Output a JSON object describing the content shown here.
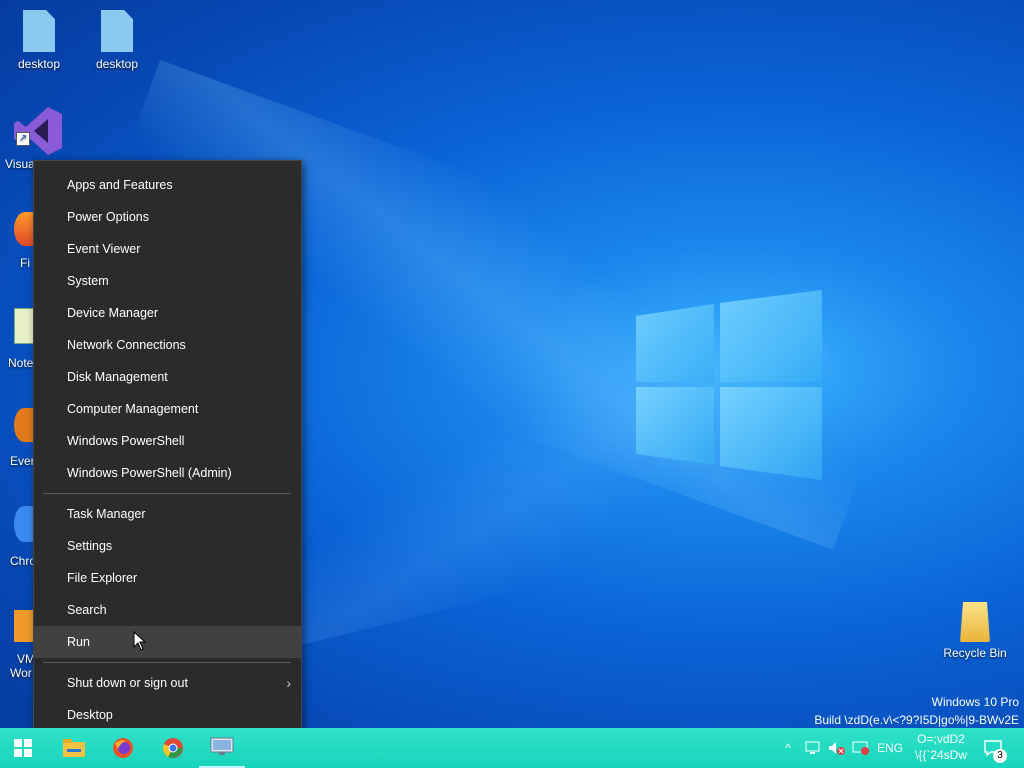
{
  "desktop_icons": [
    {
      "label": "desktop",
      "icon": "document-icon"
    },
    {
      "label": "desktop",
      "icon": "document-icon"
    }
  ],
  "partial_icons": [
    {
      "label": "Visua",
      "icon": "visual-studio-icon"
    },
    {
      "label": "Fi",
      "icon": "firefox-icon"
    },
    {
      "label": "Note",
      "icon": "notepad-icon"
    },
    {
      "label": "Ever",
      "icon": "everything-icon"
    },
    {
      "label": "Chro",
      "icon": "chrome-icon"
    },
    {
      "label": "VM",
      "icon": "vmware-icon"
    },
    {
      "label": "Wor",
      "icon": "vmware-icon"
    }
  ],
  "menu": {
    "group1": [
      "Apps and Features",
      "Power Options",
      "Event Viewer",
      "System",
      "Device Manager",
      "Network Connections",
      "Disk Management",
      "Computer Management",
      "Windows PowerShell",
      "Windows PowerShell (Admin)"
    ],
    "group2": [
      "Task Manager",
      "Settings",
      "File Explorer",
      "Search",
      "Run"
    ],
    "group3": [
      "Shut down or sign out",
      "Desktop"
    ],
    "hovered": "Run"
  },
  "recycle_bin": {
    "label": "Recycle Bin"
  },
  "watermark": {
    "line1": "Windows 10 Pro",
    "line2": "Build \\zdD(e.v\\<?9?I5D|go%|9-BWv2E"
  },
  "taskbar": {
    "apps": [
      "windows-start-icon",
      "file-explorer-icon",
      "firefox-icon",
      "chrome-icon",
      "remote-desktop-icon"
    ],
    "tray": {
      "language": "ENG",
      "clock_line1": "O=;vdD2",
      "clock_line2": "\\{{`24sDw",
      "notification_count": "3"
    }
  },
  "colors": {
    "taskbar": "#1de0c5",
    "menu_bg": "#2b2b2b",
    "desktop": "#0a63d6"
  }
}
